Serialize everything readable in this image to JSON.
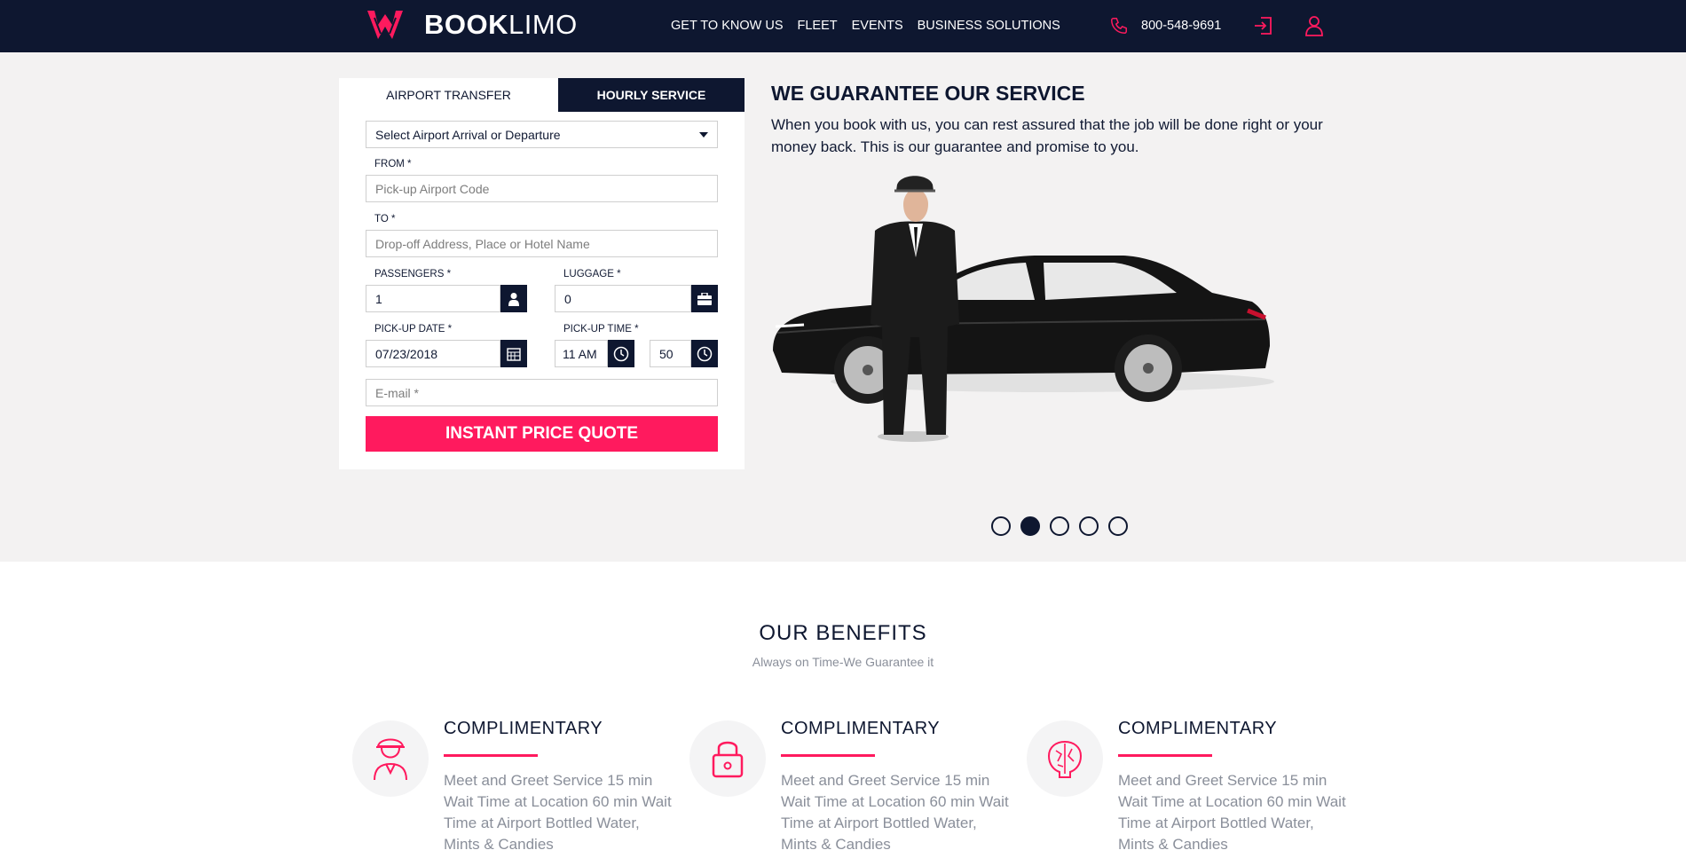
{
  "header": {
    "brand_bold": "BOOK",
    "brand_light": "LIMO",
    "nav": [
      "GET TO KNOW US",
      "FLEET",
      "EVENTS",
      "BUSINESS SOLUTIONS"
    ],
    "phone": "800-548-9691"
  },
  "booking": {
    "tabs": [
      "AIRPORT TRANSFER",
      "HOURLY SERVICE"
    ],
    "airport_select": "Select Airport Arrival or Departure",
    "from_label": "FROM *",
    "from_placeholder": "Pick-up Airport Code",
    "to_label": "TO *",
    "to_placeholder": "Drop-off Address, Place or Hotel Name",
    "passengers_label": "PASSENGERS *",
    "passengers_value": "1",
    "luggage_label": "LUGGAGE *",
    "luggage_value": "0",
    "date_label": "PICK-UP DATE *",
    "date_value": "07/23/2018",
    "time_label": "PICK-UP TIME *",
    "hour_value": "11 AM",
    "minute_value": "50",
    "email_placeholder": "E-mail *",
    "cta_label": "INSTANT PRICE QUOTE"
  },
  "hero": {
    "title": "WE GUARANTEE OUR SERVICE",
    "body": "When you book with us, you can rest assured that the job will be done right or your money back. This is our guarantee and promise to you.",
    "slides": 5,
    "active_slide": 2
  },
  "benefits": {
    "title": "OUR BENEFITS",
    "subtitle": "Always on Time-We Guarantee it",
    "items": [
      {
        "icon": "chauffeur-icon",
        "title": "COMPLIMENTARY",
        "text": "Meet and Greet Service 15 min Wait Time at Location 60 min Wait Time at Airport Bottled Water, Mints & Candies"
      },
      {
        "icon": "lock-icon",
        "title": "COMPLIMENTARY",
        "text": "Meet and Greet Service 15 min Wait Time at Location 60 min Wait Time at Airport Bottled Water, Mints & Candies"
      },
      {
        "icon": "brain-icon",
        "title": "COMPLIMENTARY",
        "text": "Meet and Greet Service 15 min Wait Time at Location 60 min Wait Time at Airport Bottled Water, Mints & Candies"
      }
    ]
  },
  "colors": {
    "navy": "#0e1730",
    "accent": "#ff1a5e",
    "hero_bg": "#f3f2f2"
  }
}
